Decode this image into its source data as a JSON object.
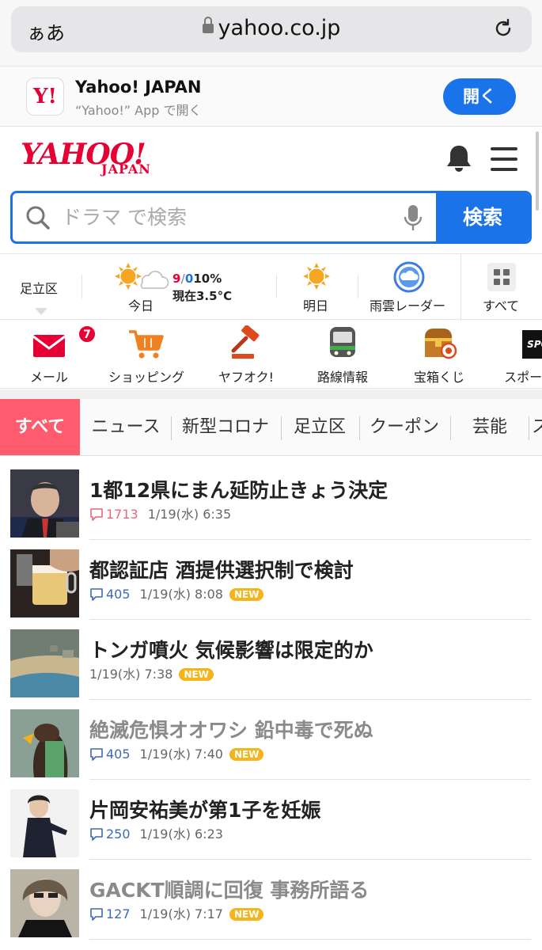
{
  "browser": {
    "text_size_label": "ぁあ",
    "url": "yahoo.co.jp"
  },
  "app_banner": {
    "title": "Yahoo! JAPAN",
    "subtitle": "“Yahoo!” App で開く",
    "open_label": "開く",
    "icon_text": "Y!"
  },
  "header": {
    "logo_main": "YAHOO!",
    "logo_sub": "JAPAN"
  },
  "search": {
    "placeholder": "ドラマ で検索",
    "button_label": "検索"
  },
  "weather": {
    "location": "足立区",
    "today_label": "今日",
    "high": "9",
    "slash": "/",
    "low": "0",
    "precip": "10%",
    "now": "現在3.5°C",
    "tomorrow_label": "明日",
    "radar_label": "雨雲レーダー",
    "all_label": "すべて"
  },
  "services": [
    {
      "label": "メール",
      "badge": "7"
    },
    {
      "label": "ショッピング"
    },
    {
      "label": "ヤフオク!"
    },
    {
      "label": "路線情報"
    },
    {
      "label": "宝箱くじ"
    },
    {
      "label": "スポーツ"
    }
  ],
  "tabs": [
    "すべて",
    "ニュース",
    "新型コロナ",
    "足立区",
    "クーポン",
    "芸能",
    "ス"
  ],
  "news": [
    {
      "title": "1都12県にまん延防止きょう決定",
      "comments": "1713",
      "time": "1/19(水) 6:35",
      "new": false,
      "visited": false,
      "hot": true
    },
    {
      "title": "都認証店 酒提供選択制で検討",
      "comments": "405",
      "time": "1/19(水) 8:08",
      "new": true,
      "visited": false,
      "hot": false
    },
    {
      "title": "トンガ噴火 気候影響は限定的か",
      "comments": "",
      "time": "1/19(水) 7:38",
      "new": true,
      "visited": false,
      "hot": false
    },
    {
      "title": "絶滅危惧オオワシ 鉛中毒で死ぬ",
      "comments": "405",
      "time": "1/19(水) 7:40",
      "new": true,
      "visited": true,
      "hot": false
    },
    {
      "title": "片岡安祐美が第1子を妊娠",
      "comments": "250",
      "time": "1/19(水) 6:23",
      "new": false,
      "visited": false,
      "hot": false
    },
    {
      "title": "GACKT順調に回復 事務所語る",
      "comments": "127",
      "time": "1/19(水) 7:17",
      "new": true,
      "visited": true,
      "hot": false
    }
  ],
  "new_badge_label": "NEW",
  "colors": {
    "brand_red": "#e60033",
    "accent_blue": "#1a73e8",
    "tab_active": "#ff5b6e",
    "new_badge": "#f4b41a"
  }
}
